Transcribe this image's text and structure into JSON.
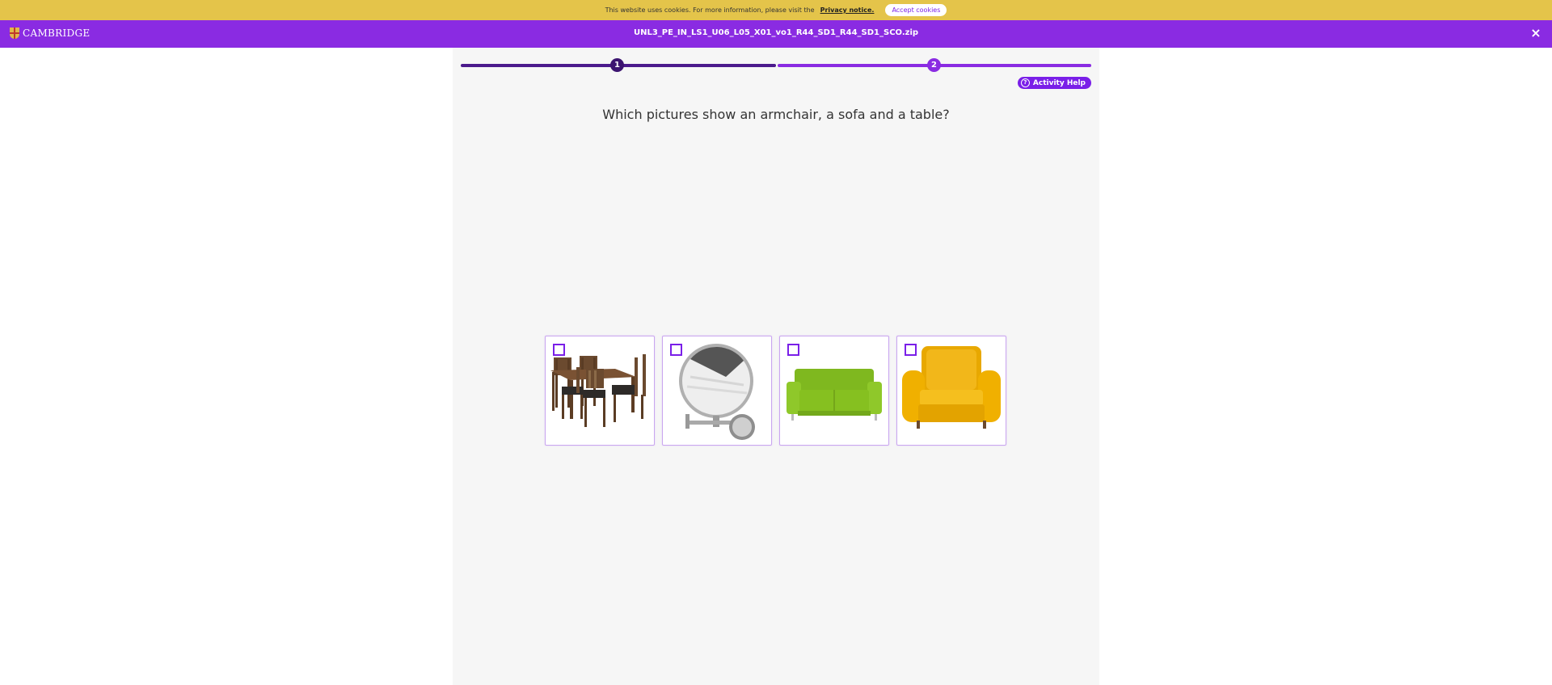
{
  "cookie_bar": {
    "text": "This website uses cookies. For more information, please visit the",
    "link": "Privacy notice.",
    "accept_label": "Accept cookies"
  },
  "header": {
    "logo_text": "CAMBRIDGE",
    "title": "UNL3_PE_IN_LS1_U06_L05_X01_vo1_R44_SD1_R44_SD1_SCO.zip",
    "close_icon": "×"
  },
  "progress": {
    "steps": [
      "1",
      "2"
    ],
    "current_step": 1
  },
  "help": {
    "icon": "?",
    "label": "Activity Help"
  },
  "question": "Which pictures show an armchair, a sofa and a table?",
  "options": [
    {
      "image": "table-with-chairs",
      "checked": false
    },
    {
      "image": "wall-mirror",
      "checked": false
    },
    {
      "image": "green-sofa",
      "checked": false
    },
    {
      "image": "yellow-armchair",
      "checked": false
    }
  ],
  "colors": {
    "cookie_bar": "#e4c44a",
    "header": "#8a2be2",
    "accent": "#7a1fe8",
    "progress_done": "#4b1a8c"
  }
}
